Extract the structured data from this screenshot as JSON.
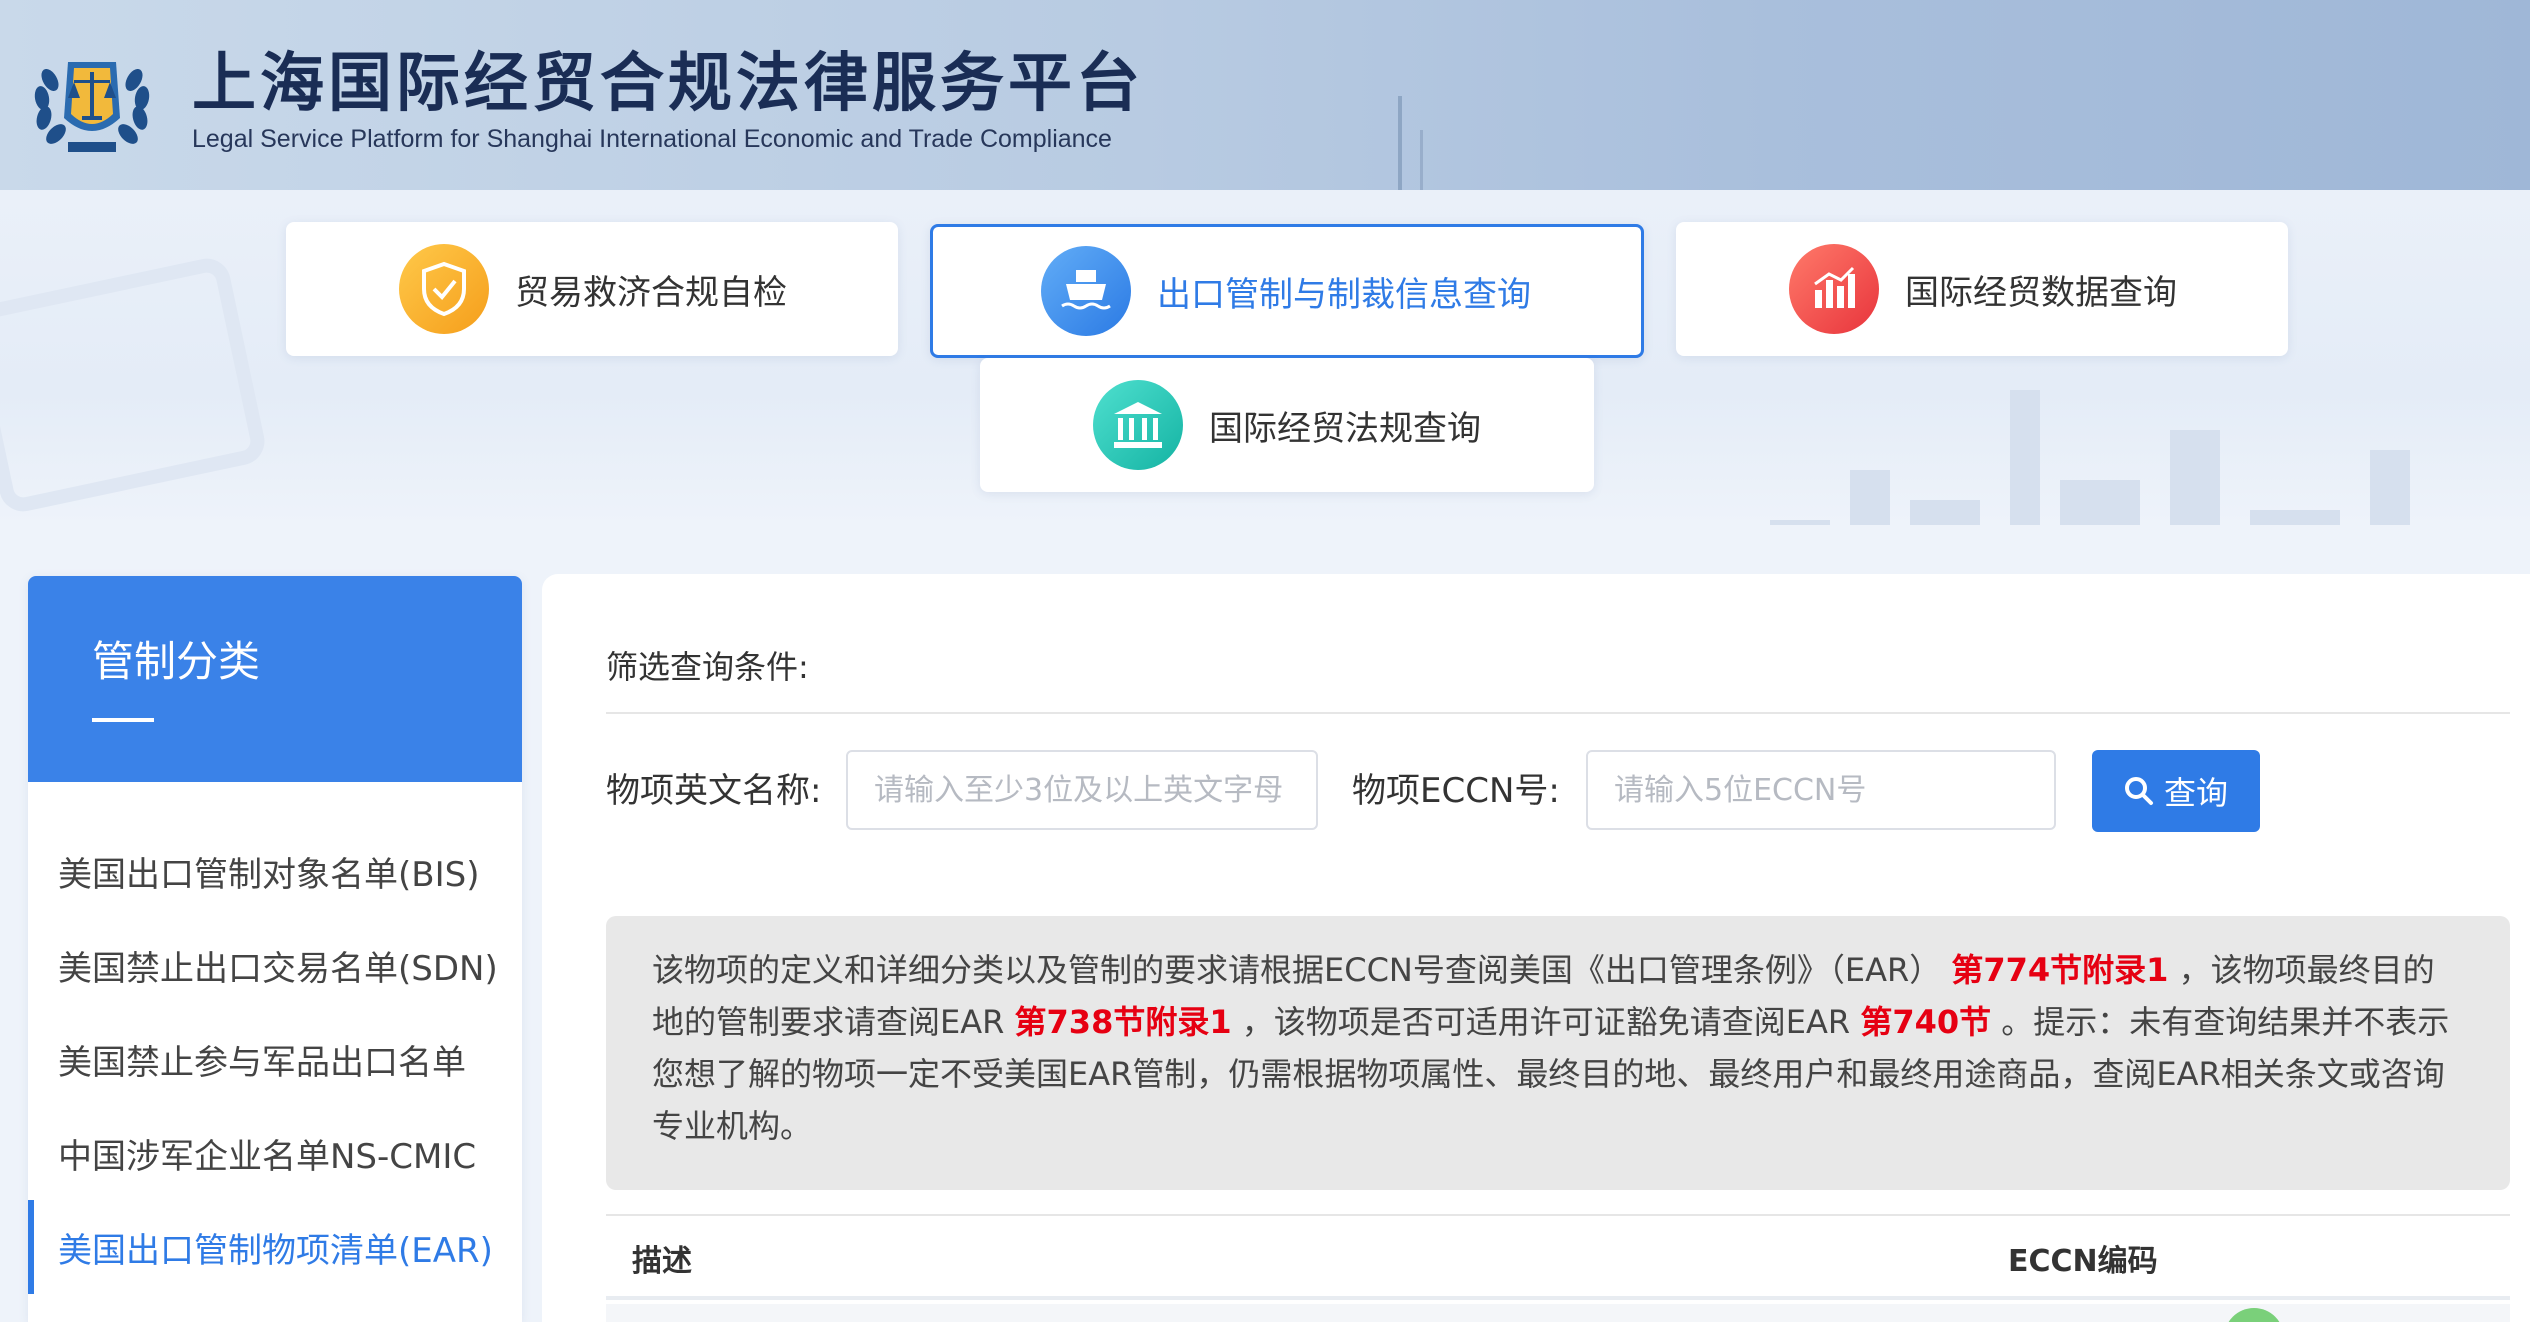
{
  "header": {
    "title": "上海国际经贸合规法律服务平台",
    "subtitle": "Legal Service Platform for Shanghai International Economic and Trade Compliance",
    "logo_icon": "scales-of-justice-emblem-icon"
  },
  "nav": {
    "cards": [
      {
        "label": "贸易救济合规自检",
        "icon": "shield-check-icon",
        "color": "#f5a623",
        "active": false
      },
      {
        "label": "出口管制与制裁信息查询",
        "icon": "ship-icon",
        "color": "#3a8ef0",
        "active": true
      },
      {
        "label": "国际经贸数据查询",
        "icon": "bar-chart-icon",
        "color": "#ef4b4b",
        "active": false
      },
      {
        "label": "国际经贸法规查询",
        "icon": "government-building-icon",
        "color": "#22c0b0",
        "active": false
      }
    ]
  },
  "sidebar": {
    "title": "管制分类",
    "items": [
      {
        "label": "美国出口管制对象名单(BIS)",
        "active": false
      },
      {
        "label": "美国禁止出口交易名单(SDN)",
        "active": false
      },
      {
        "label": "美国禁止参与军品出口名单",
        "active": false
      },
      {
        "label": "中国涉军企业名单NS-CMIC",
        "active": false
      },
      {
        "label": "美国出口管制物项清单(EAR)",
        "active": true
      }
    ]
  },
  "filter": {
    "title": "筛选查询条件:",
    "name_label": "物项英文名称:",
    "name_placeholder": "请输入至少3位及以上英文字母",
    "name_value": "",
    "eccn_label": "物项ECCN号:",
    "eccn_placeholder": "请输入5位ECCN号",
    "eccn_value": "",
    "search_label": "查询",
    "search_icon": "search-icon"
  },
  "notice": {
    "part1": "该物项的定义和详细分类以及管制的要求请根据ECCN号查阅美国《出口管理条例》（EAR）",
    "link1": "第774节附录1",
    "part2": "，该物项最终目的地的管制要求请查阅EAR",
    "link2": "第738节附录1",
    "part3": "，该物项是否可适用许可证豁免请查阅EAR",
    "link3": "第740节",
    "part4": "。提示：未有查询结果并不表示您想了解的物项一定不受美国EAR管制，仍需根据物项属性、最终目的地、最终用户和最终用途商品，查阅EAR相关条文或咨询专业机构。"
  },
  "table": {
    "columns": [
      "描述",
      "ECCN编码"
    ]
  },
  "colors": {
    "primary": "#2f7be6",
    "highlight": "#e60012"
  }
}
